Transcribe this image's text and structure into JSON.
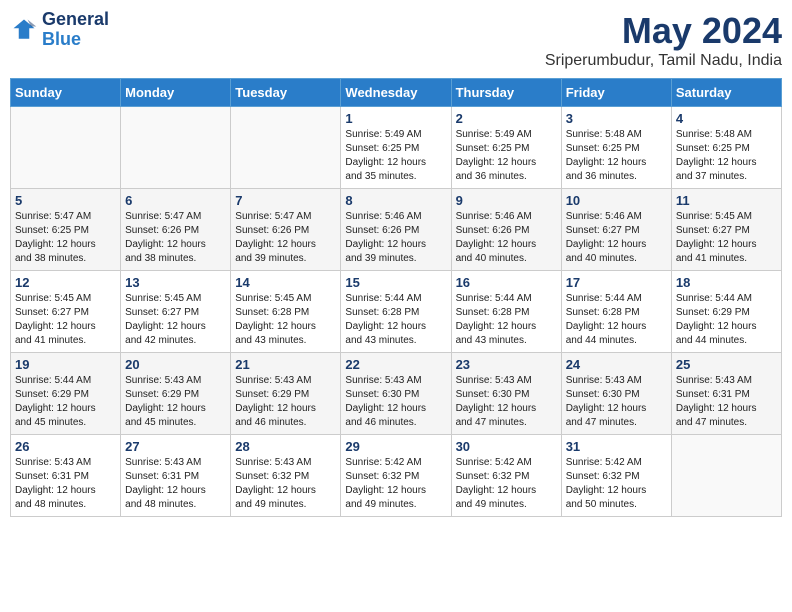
{
  "header": {
    "logo_line1": "General",
    "logo_line2": "Blue",
    "month": "May 2024",
    "location": "Sriperumbudur, Tamil Nadu, India"
  },
  "weekdays": [
    "Sunday",
    "Monday",
    "Tuesday",
    "Wednesday",
    "Thursday",
    "Friday",
    "Saturday"
  ],
  "weeks": [
    [
      {
        "day": "",
        "info": ""
      },
      {
        "day": "",
        "info": ""
      },
      {
        "day": "",
        "info": ""
      },
      {
        "day": "1",
        "info": "Sunrise: 5:49 AM\nSunset: 6:25 PM\nDaylight: 12 hours\nand 35 minutes."
      },
      {
        "day": "2",
        "info": "Sunrise: 5:49 AM\nSunset: 6:25 PM\nDaylight: 12 hours\nand 36 minutes."
      },
      {
        "day": "3",
        "info": "Sunrise: 5:48 AM\nSunset: 6:25 PM\nDaylight: 12 hours\nand 36 minutes."
      },
      {
        "day": "4",
        "info": "Sunrise: 5:48 AM\nSunset: 6:25 PM\nDaylight: 12 hours\nand 37 minutes."
      }
    ],
    [
      {
        "day": "5",
        "info": "Sunrise: 5:47 AM\nSunset: 6:25 PM\nDaylight: 12 hours\nand 38 minutes."
      },
      {
        "day": "6",
        "info": "Sunrise: 5:47 AM\nSunset: 6:26 PM\nDaylight: 12 hours\nand 38 minutes."
      },
      {
        "day": "7",
        "info": "Sunrise: 5:47 AM\nSunset: 6:26 PM\nDaylight: 12 hours\nand 39 minutes."
      },
      {
        "day": "8",
        "info": "Sunrise: 5:46 AM\nSunset: 6:26 PM\nDaylight: 12 hours\nand 39 minutes."
      },
      {
        "day": "9",
        "info": "Sunrise: 5:46 AM\nSunset: 6:26 PM\nDaylight: 12 hours\nand 40 minutes."
      },
      {
        "day": "10",
        "info": "Sunrise: 5:46 AM\nSunset: 6:27 PM\nDaylight: 12 hours\nand 40 minutes."
      },
      {
        "day": "11",
        "info": "Sunrise: 5:45 AM\nSunset: 6:27 PM\nDaylight: 12 hours\nand 41 minutes."
      }
    ],
    [
      {
        "day": "12",
        "info": "Sunrise: 5:45 AM\nSunset: 6:27 PM\nDaylight: 12 hours\nand 41 minutes."
      },
      {
        "day": "13",
        "info": "Sunrise: 5:45 AM\nSunset: 6:27 PM\nDaylight: 12 hours\nand 42 minutes."
      },
      {
        "day": "14",
        "info": "Sunrise: 5:45 AM\nSunset: 6:28 PM\nDaylight: 12 hours\nand 43 minutes."
      },
      {
        "day": "15",
        "info": "Sunrise: 5:44 AM\nSunset: 6:28 PM\nDaylight: 12 hours\nand 43 minutes."
      },
      {
        "day": "16",
        "info": "Sunrise: 5:44 AM\nSunset: 6:28 PM\nDaylight: 12 hours\nand 43 minutes."
      },
      {
        "day": "17",
        "info": "Sunrise: 5:44 AM\nSunset: 6:28 PM\nDaylight: 12 hours\nand 44 minutes."
      },
      {
        "day": "18",
        "info": "Sunrise: 5:44 AM\nSunset: 6:29 PM\nDaylight: 12 hours\nand 44 minutes."
      }
    ],
    [
      {
        "day": "19",
        "info": "Sunrise: 5:44 AM\nSunset: 6:29 PM\nDaylight: 12 hours\nand 45 minutes."
      },
      {
        "day": "20",
        "info": "Sunrise: 5:43 AM\nSunset: 6:29 PM\nDaylight: 12 hours\nand 45 minutes."
      },
      {
        "day": "21",
        "info": "Sunrise: 5:43 AM\nSunset: 6:29 PM\nDaylight: 12 hours\nand 46 minutes."
      },
      {
        "day": "22",
        "info": "Sunrise: 5:43 AM\nSunset: 6:30 PM\nDaylight: 12 hours\nand 46 minutes."
      },
      {
        "day": "23",
        "info": "Sunrise: 5:43 AM\nSunset: 6:30 PM\nDaylight: 12 hours\nand 47 minutes."
      },
      {
        "day": "24",
        "info": "Sunrise: 5:43 AM\nSunset: 6:30 PM\nDaylight: 12 hours\nand 47 minutes."
      },
      {
        "day": "25",
        "info": "Sunrise: 5:43 AM\nSunset: 6:31 PM\nDaylight: 12 hours\nand 47 minutes."
      }
    ],
    [
      {
        "day": "26",
        "info": "Sunrise: 5:43 AM\nSunset: 6:31 PM\nDaylight: 12 hours\nand 48 minutes."
      },
      {
        "day": "27",
        "info": "Sunrise: 5:43 AM\nSunset: 6:31 PM\nDaylight: 12 hours\nand 48 minutes."
      },
      {
        "day": "28",
        "info": "Sunrise: 5:43 AM\nSunset: 6:32 PM\nDaylight: 12 hours\nand 49 minutes."
      },
      {
        "day": "29",
        "info": "Sunrise: 5:42 AM\nSunset: 6:32 PM\nDaylight: 12 hours\nand 49 minutes."
      },
      {
        "day": "30",
        "info": "Sunrise: 5:42 AM\nSunset: 6:32 PM\nDaylight: 12 hours\nand 49 minutes."
      },
      {
        "day": "31",
        "info": "Sunrise: 5:42 AM\nSunset: 6:32 PM\nDaylight: 12 hours\nand 50 minutes."
      },
      {
        "day": "",
        "info": ""
      }
    ]
  ]
}
